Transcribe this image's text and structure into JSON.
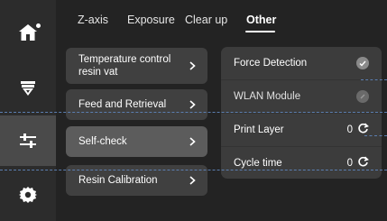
{
  "sidebar": {
    "items": [
      {
        "icon": "home-icon",
        "active": false
      },
      {
        "icon": "printer-icon",
        "active": false
      },
      {
        "icon": "sliders-icon",
        "active": true
      },
      {
        "icon": "gear-icon",
        "active": false
      }
    ]
  },
  "tabs": [
    {
      "label": "Z-axis",
      "active": false
    },
    {
      "label": "Exposure",
      "active": false
    },
    {
      "label": "Clear up",
      "active": false
    },
    {
      "label": "Other",
      "active": true
    }
  ],
  "menu": {
    "items": [
      {
        "label": "Temperature control resin vat",
        "selected": false
      },
      {
        "label": "Feed and Retrieval",
        "selected": false
      },
      {
        "label": "Self-check",
        "selected": true
      },
      {
        "label": "Resin Calibration",
        "selected": false
      }
    ]
  },
  "panel": {
    "rows": [
      {
        "label": "Force Detection",
        "state": "checked"
      },
      {
        "label": "WLAN Module",
        "state": "disabled"
      },
      {
        "label": "Print Layer",
        "count": "0",
        "action": "refresh-icon"
      },
      {
        "label": "Cycle time",
        "count": "0",
        "action": "refresh-icon"
      }
    ]
  },
  "colors": {
    "background": "#232323",
    "sidebar": "#2c2c2c",
    "sidebar_active": "#4a4a4a",
    "button": "#404040",
    "button_selected": "#5c5c5c",
    "panel": "#3c3c3c",
    "dashed_guides": "#5b7eb0"
  }
}
